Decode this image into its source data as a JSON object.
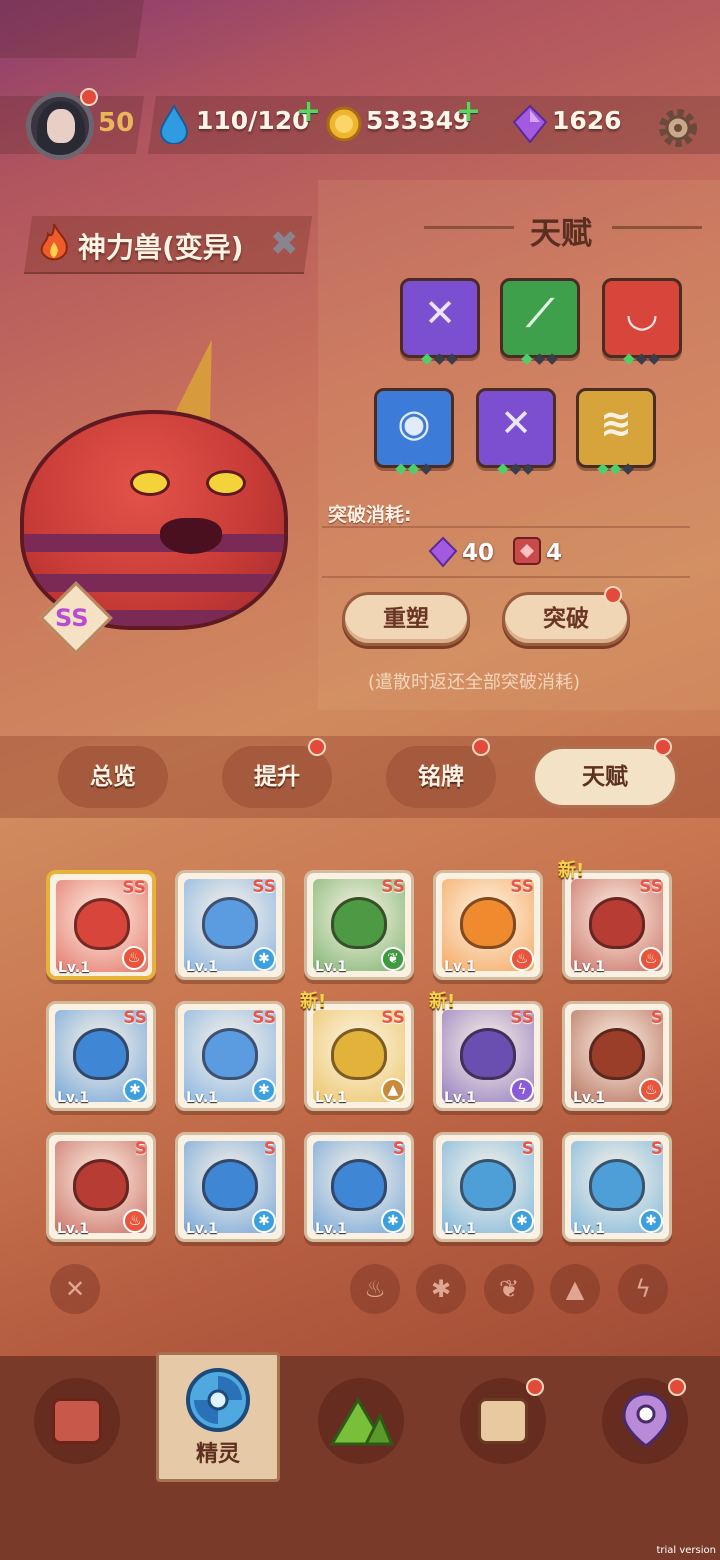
{
  "player": {
    "level": "50"
  },
  "resources": {
    "stamina": "110/120",
    "coins": "533349",
    "gems": "1626"
  },
  "monster": {
    "name": "神力兽(变异)",
    "rank": "SS"
  },
  "talent": {
    "title": "天赋",
    "tiles": [
      {
        "icon": "slash-icon",
        "color": "#7b4fd0",
        "glyph": "✕",
        "gems": 1
      },
      {
        "icon": "claw-icon",
        "color": "#3fa04c",
        "glyph": "⟋",
        "gems": 1
      },
      {
        "icon": "fang-icon",
        "color": "#d8453a",
        "glyph": "◡",
        "gems": 1
      },
      {
        "icon": "eye-icon",
        "color": "#3d7bd8",
        "glyph": "◉",
        "gems": 2
      },
      {
        "icon": "slash-icon",
        "color": "#7b4fd0",
        "glyph": "✕",
        "gems": 1
      },
      {
        "icon": "scale-icon",
        "color": "#d6a43a",
        "glyph": "≋",
        "gems": 2
      }
    ],
    "cost_label": "突破消耗:",
    "cost_gems": "40",
    "cost_books": "4",
    "reshape_button": "重塑",
    "breakthrough_button": "突破",
    "note": "(遣散时返还全部突破消耗)"
  },
  "tabs": [
    {
      "label": "总览",
      "active": false
    },
    {
      "label": "提升",
      "active": false
    },
    {
      "label": "铭牌",
      "active": false
    },
    {
      "label": "天赋",
      "active": true
    }
  ],
  "cards": [
    {
      "name": "card-red-horn-beast",
      "rank": "SS",
      "lv": "Lv.1",
      "color": "#d8453a",
      "el": "fire",
      "selected": true
    },
    {
      "name": "card-blue-tiger",
      "rank": "SS",
      "lv": "Lv.1",
      "color": "#5b9be0",
      "el": "ice"
    },
    {
      "name": "card-green-monkey",
      "rank": "SS",
      "lv": "Lv.1",
      "color": "#4d9a45",
      "el": "leaf"
    },
    {
      "name": "card-orange-fox",
      "rank": "SS",
      "lv": "Lv.1",
      "color": "#f08a2e",
      "el": "fire"
    },
    {
      "name": "card-red-bull",
      "rank": "SS",
      "lv": "Lv.1",
      "color": "#b63c34",
      "el": "fire",
      "new": "新!"
    },
    {
      "name": "card-blue-fish",
      "rank": "SS",
      "lv": "Lv.1",
      "color": "#3f87d4",
      "el": "ice"
    },
    {
      "name": "card-blue-tiger-2",
      "rank": "SS",
      "lv": "Lv.1",
      "color": "#5b9be0",
      "el": "ice"
    },
    {
      "name": "card-sunflower",
      "rank": "SS",
      "lv": "Lv.1",
      "color": "#e3b23a",
      "el": "earth",
      "new": "新!"
    },
    {
      "name": "card-purple-croc",
      "rank": "SS",
      "lv": "Lv.1",
      "color": "#6a4fb0",
      "el": "thunder",
      "new": "新!"
    },
    {
      "name": "card-furnace-golem",
      "rank": "S",
      "lv": "Lv.1",
      "color": "#9a3e2a",
      "el": "fire"
    },
    {
      "name": "card-red-bull-2",
      "rank": "S",
      "lv": "Lv.1",
      "color": "#b63c34",
      "el": "fire"
    },
    {
      "name": "card-blue-fish-2",
      "rank": "S",
      "lv": "Lv.1",
      "color": "#3f87d4",
      "el": "ice"
    },
    {
      "name": "card-blue-fish-3",
      "rank": "S",
      "lv": "Lv.1",
      "color": "#3f87d4",
      "el": "ice"
    },
    {
      "name": "card-owl",
      "rank": "S",
      "lv": "Lv.1",
      "color": "#4e9fd8",
      "el": "ice"
    },
    {
      "name": "card-owl-2",
      "rank": "S",
      "lv": "Lv.1",
      "color": "#4e9fd8",
      "el": "ice"
    }
  ],
  "element_colors": {
    "fire": "#e8553a",
    "ice": "#3aa0e0",
    "leaf": "#3e9a3e",
    "earth": "#c98a3a",
    "thunder": "#8a5ad8"
  },
  "filters": [
    "close-icon",
    "fire-icon",
    "ice-icon",
    "leaf-icon",
    "earth-icon",
    "thunder-icon"
  ],
  "bottom_nav": {
    "items": [
      "shop-icon",
      "spirit-icon",
      "map-icon",
      "chest-icon",
      "location-icon"
    ],
    "active_label": "精灵"
  },
  "watermark": "trial version"
}
